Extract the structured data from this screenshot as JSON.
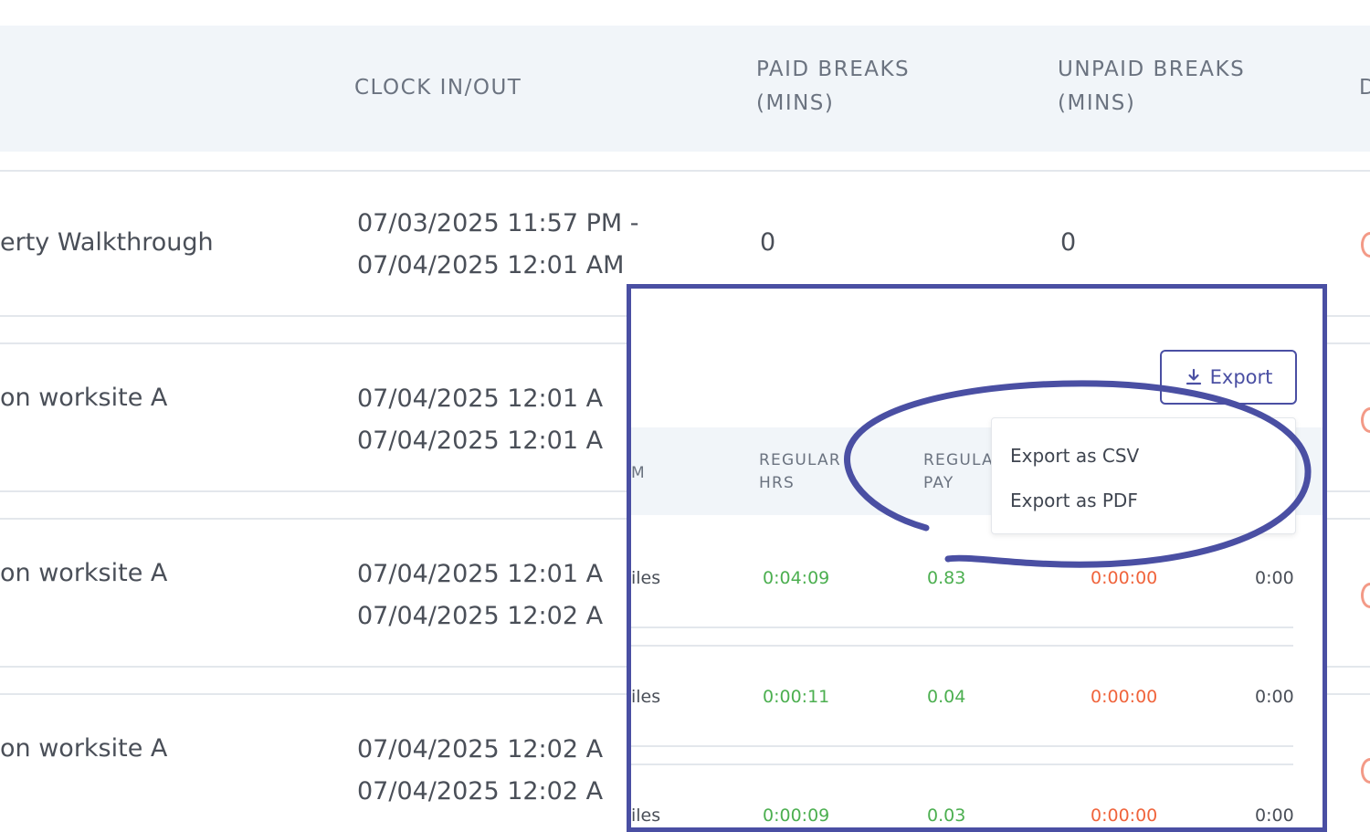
{
  "table": {
    "headers": {
      "clock": "CLOCK IN/OUT",
      "paid_line1": "PAID BREAKS",
      "paid_line2": "(MINS)",
      "unpaid_line1": "UNPAID BREAKS",
      "unpaid_line2": "(MINS)",
      "edge": "D"
    },
    "rows": [
      {
        "desc": "erty Walkthrough",
        "clock_in": "07/03/2025 11:57 PM -",
        "clock_out": "07/04/2025 12:01 AM",
        "paid": "0",
        "unpaid": "0"
      },
      {
        "desc": "on worksite A",
        "clock_in": "07/04/2025 12:01 A",
        "clock_out": "07/04/2025 12:01 A"
      },
      {
        "desc": "on worksite A",
        "clock_in": "07/04/2025 12:01 A",
        "clock_out": "07/04/2025 12:02 A"
      },
      {
        "desc": "on worksite A",
        "clock_in": "07/04/2025 12:02 A",
        "clock_out": "07/04/2025 12:02 A"
      }
    ]
  },
  "inset": {
    "export_label": "Export",
    "headers": {
      "partial": "M",
      "regular_hrs_1": "REGULAR",
      "regular_hrs_2": "HRS",
      "regular_pay_1": "REGULA",
      "regular_pay_2": "PAY"
    },
    "rows": [
      {
        "partial": "iles",
        "regular_hrs": "0:04:09",
        "regular_pay": "0.83",
        "overtime": "0:00:00",
        "last": "0:00"
      },
      {
        "partial": "iles",
        "regular_hrs": "0:00:11",
        "regular_pay": "0.04",
        "overtime": "0:00:00",
        "last": "0:00"
      },
      {
        "partial": "iles",
        "regular_hrs": "0:00:09",
        "regular_pay": "0.03",
        "overtime": "0:00:00",
        "last": "0:00"
      }
    ],
    "dropdown": {
      "csv": "Export as CSV",
      "pdf": "Export as PDF"
    }
  },
  "colors": {
    "accent": "#4a4fa3",
    "positive": "#4caf50",
    "warning": "#f0643c",
    "header_bg": "#f1f5f9"
  }
}
